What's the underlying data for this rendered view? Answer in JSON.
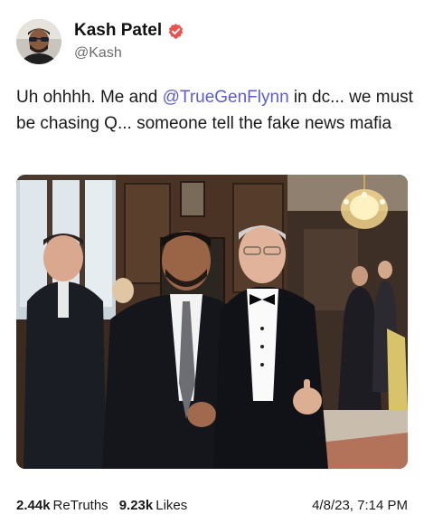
{
  "post": {
    "author": {
      "display_name": "Kash Patel",
      "handle": "@Kash",
      "verified_icon": "verified-badge-icon",
      "verified_color": "#e8534e"
    },
    "text_parts": {
      "before_mention": "Uh ohhhh. Me and ",
      "mention": "@TrueGenFlynn",
      "after_mention": " in dc... we must be chasing Q... someone tell the fake news mafia"
    },
    "mention_color": "#5b5bd6",
    "image": {
      "subject": "photo-two-men-in-tuxedos-at-formal-event"
    },
    "stats": {
      "retruths_count": "2.44k",
      "retruths_label": "ReTruths",
      "likes_count": "9.23k",
      "likes_label": "Likes"
    },
    "timestamp": "4/8/23, 7:14 PM"
  }
}
